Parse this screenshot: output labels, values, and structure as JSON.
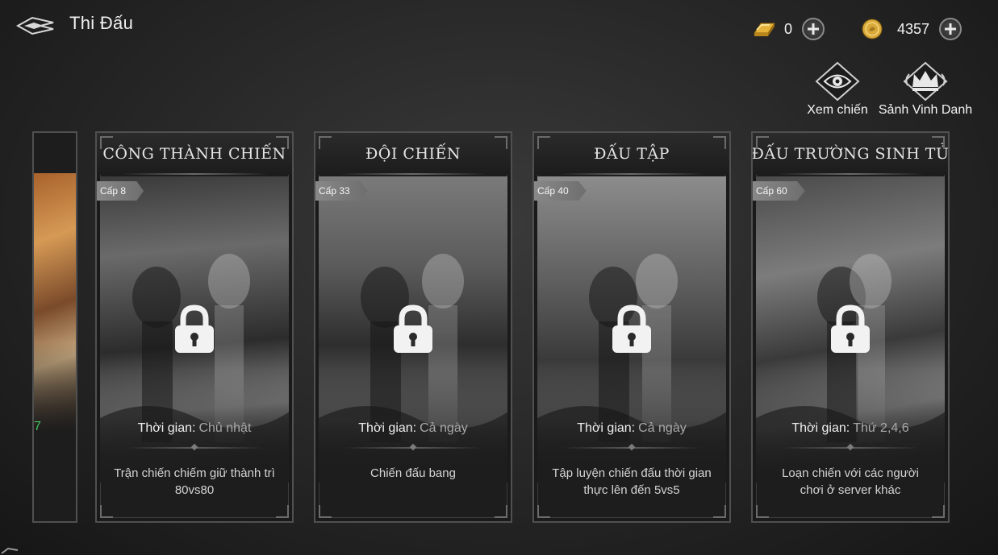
{
  "header": {
    "title": "Thi Đấu",
    "back_icon": "back-arrow-icon"
  },
  "currencies": [
    {
      "icon": "gold-bar-icon",
      "value": "0"
    },
    {
      "icon": "gold-coin-icon",
      "value": "4357"
    }
  ],
  "top_actions": {
    "spectate": {
      "icon": "eye-emblem-icon",
      "label": "Xem chiến"
    },
    "hall_of_fame": {
      "icon": "crown-emblem-icon",
      "label": "Sảnh Vinh Danh"
    }
  },
  "partial_card": {
    "time_fragment": "7"
  },
  "modes": [
    {
      "title": "CÔNG THÀNH CHIẾN",
      "level": "Cấp 8",
      "time_label": "Thời gian:",
      "time_value": "Chủ nhật",
      "description": "Trận chiến chiếm giữ thành trì 80vs80",
      "locked": true
    },
    {
      "title": "ĐỘI CHIẾN",
      "level": "Cấp 33",
      "time_label": "Thời gian:",
      "time_value": "Cả ngày",
      "description": "Chiến đấu bang",
      "locked": true
    },
    {
      "title": "ĐẤU TẬP",
      "level": "Cấp 40",
      "time_label": "Thời gian:",
      "time_value": "Cả ngày",
      "description": "Tập luyện chiến đấu thời gian thực lên đến 5vs5",
      "locked": true
    },
    {
      "title": "ĐẤU TRƯỜNG SINH TỬ",
      "level": "Cấp 60",
      "time_label": "Thời gian:",
      "time_value": "Thứ 2,4,6",
      "description": "Loạn chiến với các người chơi ở server khác",
      "locked": true
    }
  ],
  "colors": {
    "background": "#2a2a2a",
    "card_border": "#505050",
    "level_tag": "#7a7a7a",
    "accent_green": "#46c25a"
  }
}
